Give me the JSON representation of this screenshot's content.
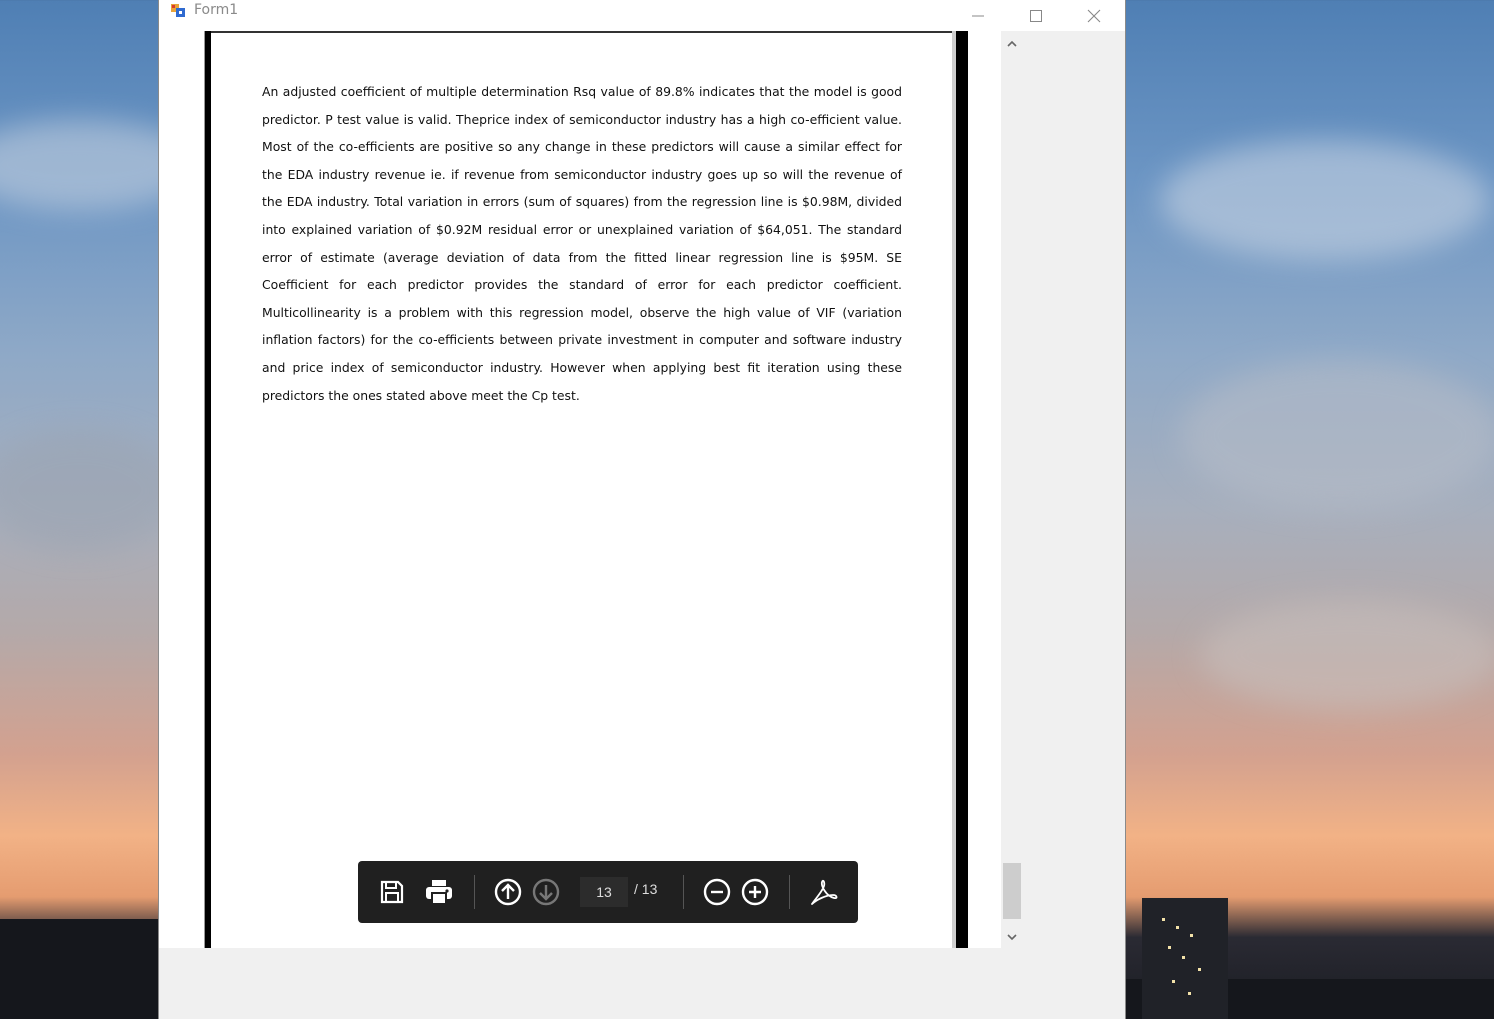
{
  "window": {
    "title": "Form1"
  },
  "document": {
    "paragraph": "An adjusted coefficient of multiple determination Rsq value of 89.8% indicates that the model is good predictor.  P test value is valid. Theprice index of semiconductor industry has a high co-efficient value. Most of the co-efficients are positive so any change in these predictors will cause a similar effect for the EDA industry revenue ie. if revenue from semiconductor industry goes up so will the revenue of the EDA industry. Total variation in errors (sum of squares) from the regression line is $0.98M, divided into explained variation of $0.92M residual error or unexplained variation of $64,051.  The standard error of estimate (average deviation of data from the fitted linear regression line is $95M. SE Coefficient for each predictor provides the standard of error for each predictor coefficient.  Multicollinearity is a problem with this regression model, observe the high value of VIF (variation inflation factors) for the co-efficients between private investment in computer and software industry and price index of semiconductor industry. However when applying best fit iteration using these predictors the ones stated above meet the Cp test."
  },
  "toolbar": {
    "current_page": "13",
    "total_pages": "/ 13",
    "icons": [
      "save-icon",
      "print-icon",
      "previous-page-icon",
      "next-page-icon",
      "zoom-out-icon",
      "zoom-in-icon",
      "acrobat-icon"
    ]
  },
  "colors": {
    "toolbar_bg": "#202020",
    "window_bg": "#f0f0f0",
    "titlebar_bg": "#ffffff"
  }
}
